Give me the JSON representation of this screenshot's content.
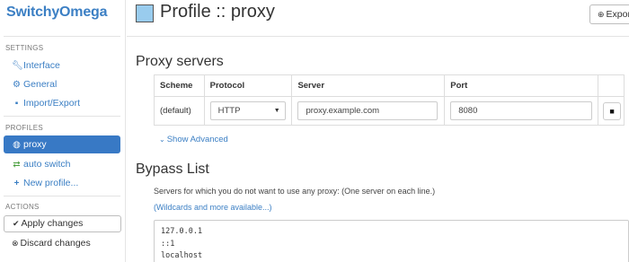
{
  "app": {
    "brand": "SwitchyOmega"
  },
  "sidebar": {
    "settings_header": "SETTINGS",
    "settings_items": [
      {
        "label": "Interface",
        "icon": "wrench-icon"
      },
      {
        "label": "General",
        "icon": "gear-icon"
      },
      {
        "label": "Import/Export",
        "icon": "floppy-icon"
      }
    ],
    "profiles_header": "PROFILES",
    "profile_items": [
      {
        "label": "proxy",
        "icon": "globe-icon",
        "active": true
      },
      {
        "label": "auto switch",
        "icon": "retweet-icon"
      },
      {
        "label": "New profile...",
        "icon": "plus-icon"
      }
    ],
    "actions_header": "ACTIONS",
    "apply_label": "Apply changes",
    "discard_label": "Discard changes"
  },
  "header": {
    "title": "Profile :: proxy",
    "swatch_color": "#99ccee",
    "export_label": "Expor"
  },
  "proxy_servers": {
    "heading": "Proxy servers",
    "columns": [
      "Scheme",
      "Protocol",
      "Server",
      "Port"
    ],
    "row": {
      "scheme": "(default)",
      "protocol": "HTTP",
      "server": "proxy.example.com",
      "port": "8080"
    },
    "show_advanced": "Show Advanced"
  },
  "bypass": {
    "heading": "Bypass List",
    "description": "Servers for which you do not want to use any proxy: (One server on each line.)",
    "wildcards_link": "(Wildcards and more available...)",
    "entries": [
      "127.0.0.1",
      "::1",
      "localhost"
    ]
  },
  "colors": {
    "accent": "#3b7fc4",
    "active_bg": "#3879c5"
  }
}
